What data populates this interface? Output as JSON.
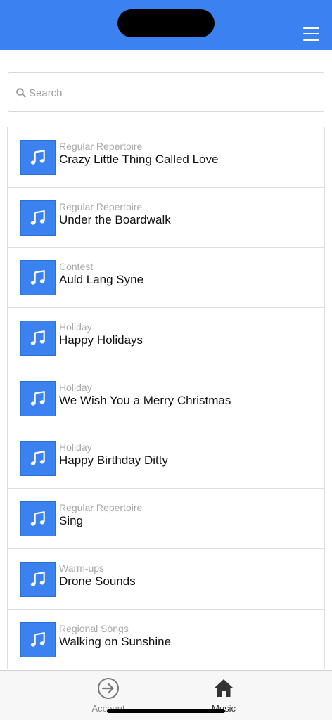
{
  "header": {
    "menu_icon": "hamburger-menu-icon",
    "background": "#3b82f0"
  },
  "search": {
    "placeholder": "Search",
    "value": "",
    "icon": "search-icon"
  },
  "songs": [
    {
      "category": "Regular Repertoire",
      "title": "Crazy Little Thing Called Love"
    },
    {
      "category": "Regular Repertoire",
      "title": "Under the Boardwalk"
    },
    {
      "category": "Contest",
      "title": "Auld Lang Syne"
    },
    {
      "category": "Holiday",
      "title": "Happy Holidays"
    },
    {
      "category": "Holiday",
      "title": "We Wish You a Merry Christmas"
    },
    {
      "category": "Holiday",
      "title": "Happy Birthday Ditty"
    },
    {
      "category": "Regular Repertoire",
      "title": "Sing"
    },
    {
      "category": "Warm-ups",
      "title": "Drone Sounds"
    },
    {
      "category": "Regional Songs",
      "title": "Walking on Sunshine"
    }
  ],
  "tabs": [
    {
      "label": "Account",
      "icon": "sign-in-icon"
    },
    {
      "label": "Music",
      "icon": "home-icon",
      "active": true
    }
  ],
  "colors": {
    "accent": "#3b82f0",
    "category_text": "#a8a8a8"
  }
}
